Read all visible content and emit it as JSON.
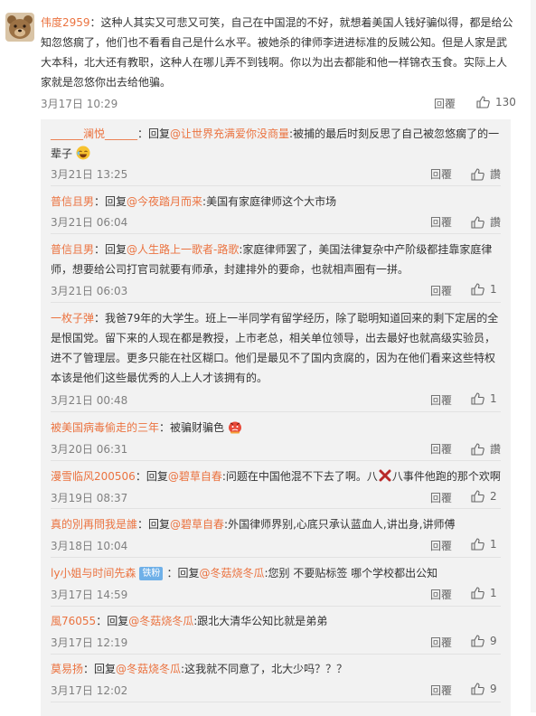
{
  "main": {
    "username": "伟度2959",
    "text": "：这种人其实又可悲又可笑，自己在中国混的不好，就想着美国人钱好骗似得，都是给公知忽悠瘸了，他们也不看看自己是什么水平。被她杀的律师李进进标准的反贼公知。但是人家是武大本科，北大还有教职，这种人在哪儿弄不到钱啊。你以为出去都能和他一样锦衣玉食。实际上人家就是忽悠你出去给他骗。",
    "time": "3月17日 10:29",
    "reply_label": "回覆",
    "likes": "130"
  },
  "replies": [
    {
      "user": "______澜悦______",
      "mid1": "：回复",
      "mention": "@让世界充满爱你没商量",
      "text": ":被捕的最后时刻反思了自己被忽悠瘸了的一辈子",
      "emoji": "laugh-emoji",
      "time": "3月21日 13:25",
      "reply_label": "回覆",
      "likes": "讚"
    },
    {
      "user": "普信且男",
      "mid1": "：回复",
      "mention": "@今夜踏月而来",
      "text": ":美国有家庭律师这个大市场",
      "time": "3月21日 06:04",
      "reply_label": "回覆",
      "likes": "讚"
    },
    {
      "user": "普信且男",
      "mid1": "：回复",
      "mention": "@人生路上一歌者-路歌",
      "text": ":家庭律师罢了，美国法律复杂中产阶级都挂靠家庭律师，想要给公司打官司就要有师承，封建排外的要命，也就相声圈有一拼。",
      "time": "3月21日 06:03",
      "reply_label": "回覆",
      "likes": "1"
    },
    {
      "user": "一枚子弹",
      "mid1": "：我爸79年的大学生。班上一半同学有留学经历，除了聪明知道回来的剩下定居的全是恨国党。留下来的人现在都是教授，上市老总，相关单位领导，出去最好也就高级实验员，进不了管理层。更多只能在社区糊口。他们是最见不了国内贪腐的，因为在他们看来这些特权本该是他们这些最优秀的人上人才该拥有的。",
      "mention": "",
      "text": "",
      "time": "3月21日 00:48",
      "reply_label": "回覆",
      "likes": "1"
    },
    {
      "user": "被美国病毒偷走的三年",
      "mid1": "：被骗财骗色",
      "mention": "",
      "text": "",
      "emoji": "angry-emoji",
      "time": "3月20日 06:31",
      "reply_label": "回覆",
      "likes": "讚"
    },
    {
      "user": "漫雪临风200506",
      "mid1": "：回复",
      "mention": "@碧草自春",
      "text": ":问题在中国他混不下去了啊。八",
      "text2": "八事件他跑的那个欢啊",
      "emoji": "cross-mark",
      "time": "3月19日 08:37",
      "reply_label": "回覆",
      "likes": "2"
    },
    {
      "user": "真的別再問我是誰",
      "mid1": "：回复",
      "mention": "@碧草自春",
      "text": ":外国律师界别,心底只承认蓝血人,讲出身,讲师傅",
      "time": "3月18日 10:04",
      "reply_label": "回覆",
      "likes": "1"
    },
    {
      "user": "ly小姐与时间先森",
      "badge": "铁粉",
      "mid1": "：回复",
      "mention": "@冬菇烧冬瓜",
      "text": ":您别 不要贴标签 哪个学校都出公知",
      "time": "3月17日 14:59",
      "reply_label": "回覆",
      "likes": "1"
    },
    {
      "user": "風76055",
      "mid1": "：回复",
      "mention": "@冬菇烧冬瓜",
      "text": ":跟北大清华公知比就是弟弟",
      "time": "3月17日 12:19",
      "reply_label": "回覆",
      "likes": "9"
    },
    {
      "user": "莫易扬",
      "mid1": "：回复",
      "mention": "@冬菇烧冬瓜",
      "text": ":这我就不同意了，北大少吗？？？",
      "time": "3月17日 12:02",
      "reply_label": "回覆",
      "likes": "9"
    }
  ],
  "colors": {
    "username": "#eb7340",
    "meta": "#808080",
    "thread_bg": "#f2f2f2",
    "badge": "#6fb0e8"
  }
}
